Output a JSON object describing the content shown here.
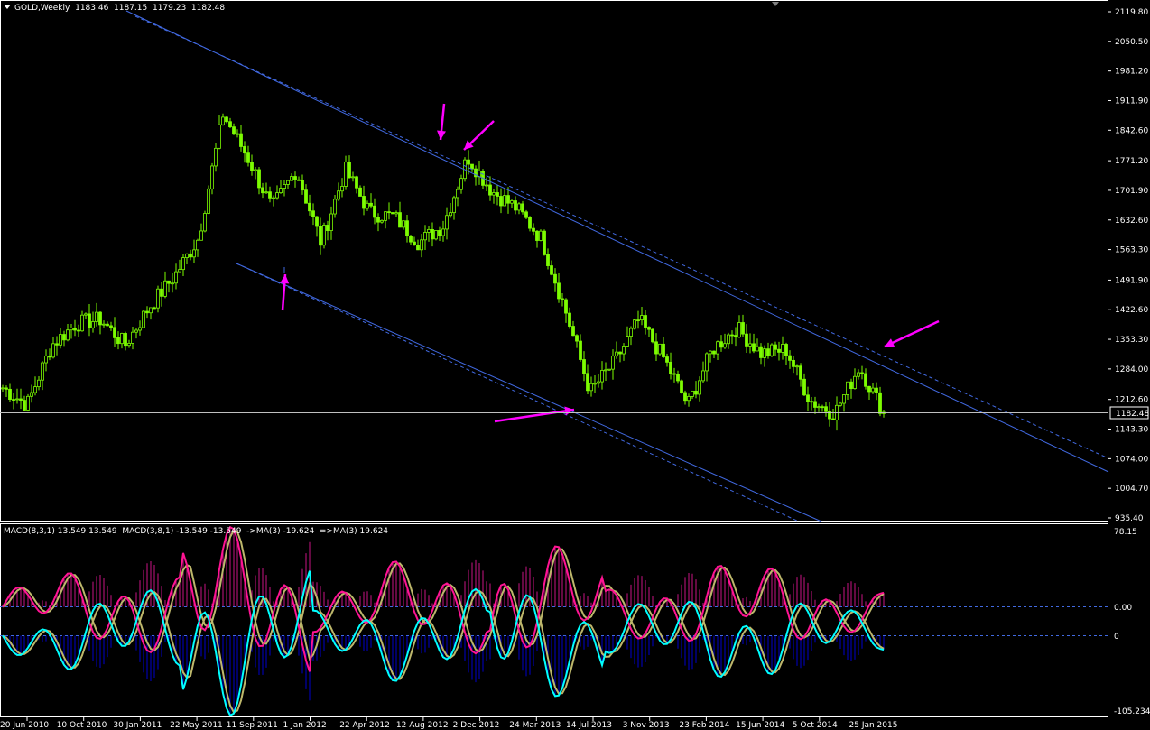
{
  "window": {
    "symbol": "GOLD,Weekly",
    "ohlc": "1183.46  1187.15  1179.23  1182.48"
  },
  "colors": {
    "background": "#000000",
    "candle": "#7CFC00",
    "trendline": "#4169E1",
    "arrow": "#FF00FF",
    "macd_histogram_pos": "#C71585",
    "macd_histogram_neg": "#0000CD",
    "macd_line_a": "#FF1493",
    "macd_line_b": "#00FFFF",
    "macd_ma": "#BDB76B",
    "axis": "#FFFFFF"
  },
  "macd_panel": {
    "label": "MACD(8,3,1) 13.549 13.549  MACD(3,8,1) -13.549 -13.549  ->MA(3) -19.624  =>MA(3) 19.624",
    "y_max_label": "78.15",
    "zero_label_upper": "0.00",
    "zero_label_lower": "0",
    "y_min_label": "-105.234"
  },
  "chart_data": {
    "type": "candlestick",
    "instrument": "GOLD",
    "timeframe": "Weekly",
    "last_price": 1182.48,
    "price_axis": {
      "ylim": [
        935.4,
        2119.8
      ],
      "ticks": [
        "2119.80",
        "2050.50",
        "1981.20",
        "1911.90",
        "1842.60",
        "1771.20",
        "1701.90",
        "1632.60",
        "1563.30",
        "1491.90",
        "1422.60",
        "1353.30",
        "1284.00",
        "1212.60",
        "1143.30",
        "1074.00",
        "1004.70",
        "935.40"
      ],
      "current_label": "1182.48"
    },
    "x_axis": {
      "tick_labels": [
        "20 Jun 2010",
        "10 Oct 2010",
        "30 Jan 2011",
        "22 May 2011",
        "11 Sep 2011",
        "1 Jan 2012",
        "22 Apr 2012",
        "12 Aug 2012",
        "2 Dec 2012",
        "24 Mar 2013",
        "14 Jul 2013",
        "3 Nov 2013",
        "23 Feb 2014",
        "15 Jun 2014",
        "5 Oct 2014",
        "25 Jan 2015"
      ]
    },
    "price_path": [
      [
        "20 Jun 2010",
        1240
      ],
      [
        "Aug 2010",
        1200
      ],
      [
        "10 Oct 2010",
        1340
      ],
      [
        "Nov 2010",
        1390
      ],
      [
        "Dec 2010",
        1400
      ],
      [
        "30 Jan 2011",
        1340
      ],
      [
        "Mar 2011",
        1430
      ],
      [
        "22 May 2011",
        1500
      ],
      [
        "Jul 2011",
        1590
      ],
      [
        "Aug 2011",
        1880
      ],
      [
        "11 Sep 2011",
        1780
      ],
      [
        "Oct 2011",
        1660
      ],
      [
        "Nov 2011",
        1750
      ],
      [
        "1 Jan 2012",
        1580
      ],
      [
        "Feb 2012",
        1750
      ],
      [
        "Mar 2012",
        1650
      ],
      [
        "22 Apr 2012",
        1640
      ],
      [
        "Jun 2012",
        1580
      ],
      [
        "12 Aug 2012",
        1620
      ],
      [
        "Oct 2012",
        1780
      ],
      [
        "2 Dec 2012",
        1700
      ],
      [
        "Feb 2013",
        1660
      ],
      [
        "24 Mar 2013",
        1590
      ],
      [
        "Apr 2013",
        1420
      ],
      [
        "Jun 2013",
        1230
      ],
      [
        "14 Jul 2013",
        1300
      ],
      [
        "Aug 2013",
        1400
      ],
      [
        "3 Nov 2013",
        1310
      ],
      [
        "Dec 2013",
        1200
      ],
      [
        "23 Feb 2014",
        1330
      ],
      [
        "Mar 2014",
        1380
      ],
      [
        "15 Jun 2014",
        1320
      ],
      [
        "Jul 2014",
        1330
      ],
      [
        "5 Oct 2014",
        1210
      ],
      [
        "Nov 2014",
        1180
      ],
      [
        "25 Jan 2015",
        1290
      ],
      [
        "Mar 2015",
        1182.48
      ]
    ],
    "macd": {
      "ylim": [
        -105.234,
        78.15
      ],
      "series": [
        {
          "name": "MACD(8,3,1)",
          "last": 13.549
        },
        {
          "name": "MACD(3,8,1)",
          "last": -13.549
        },
        {
          "name": "->MA(3)",
          "last": -19.624
        },
        {
          "name": "=>MA(3)",
          "last": 19.624
        }
      ]
    }
  }
}
